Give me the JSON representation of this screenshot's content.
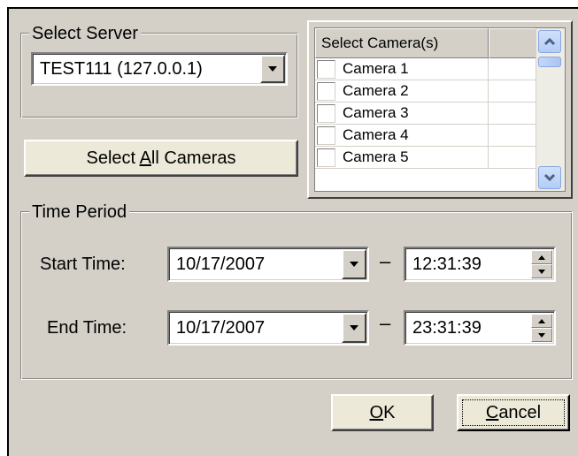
{
  "select_server": {
    "legend": "Select Server",
    "value": "TEST111 (127.0.0.1)"
  },
  "select_all_button": {
    "prefix": "Select ",
    "accel": "A",
    "suffix": "ll Cameras"
  },
  "camera_list": {
    "header": "Select Camera(s)",
    "items": [
      {
        "label": "Camera 1",
        "checked": false
      },
      {
        "label": "Camera 2",
        "checked": false
      },
      {
        "label": "Camera 3",
        "checked": false
      },
      {
        "label": "Camera 4",
        "checked": false
      },
      {
        "label": "Camera 5",
        "checked": false
      }
    ]
  },
  "time_period": {
    "legend": "Time Period",
    "start": {
      "label": "Start Time:",
      "date": "10/17/2007",
      "separator": "–",
      "time": "12:31:39"
    },
    "end": {
      "label": "End Time:",
      "date": "10/17/2007",
      "separator": "–",
      "time": "23:31:39"
    }
  },
  "buttons": {
    "ok_accel": "O",
    "ok_rest": "K",
    "cancel_accel": "C",
    "cancel_rest": "ancel"
  },
  "icons": {
    "dropdown": "chevron-down-icon",
    "scroll_up": "chevron-up-icon",
    "scroll_down": "chevron-down-icon",
    "spin": "spin-arrows-icon"
  },
  "colors": {
    "dialog_bg": "#d4d0c8",
    "button_face": "#ece9d8",
    "scroll_blue": "#b4cdf6",
    "arrow_blue": "#4d6185"
  }
}
